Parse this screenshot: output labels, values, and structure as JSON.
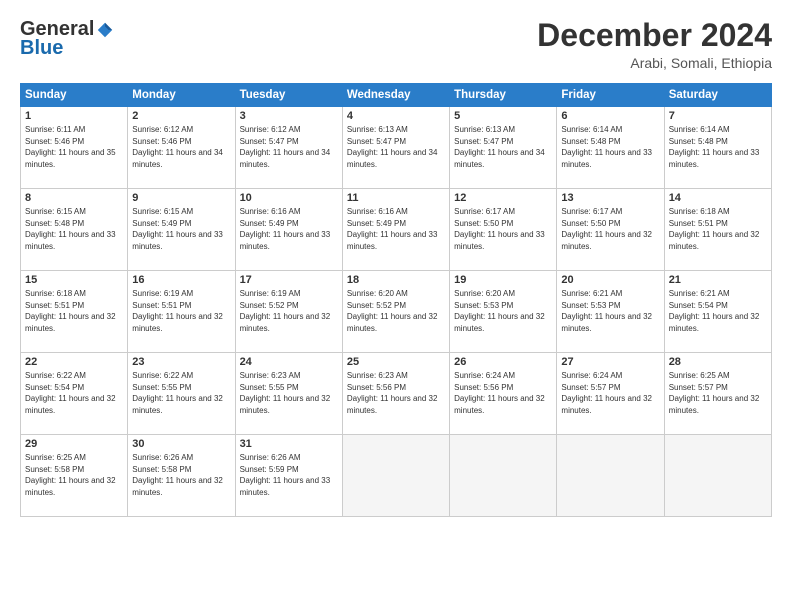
{
  "logo": {
    "general": "General",
    "blue": "Blue"
  },
  "title": "December 2024",
  "subtitle": "Arabi, Somali, Ethiopia",
  "days_header": [
    "Sunday",
    "Monday",
    "Tuesday",
    "Wednesday",
    "Thursday",
    "Friday",
    "Saturday"
  ],
  "weeks": [
    [
      {
        "day": "1",
        "sunrise": "6:11 AM",
        "sunset": "5:46 PM",
        "daylight": "11 hours and 35 minutes."
      },
      {
        "day": "2",
        "sunrise": "6:12 AM",
        "sunset": "5:46 PM",
        "daylight": "11 hours and 34 minutes."
      },
      {
        "day": "3",
        "sunrise": "6:12 AM",
        "sunset": "5:47 PM",
        "daylight": "11 hours and 34 minutes."
      },
      {
        "day": "4",
        "sunrise": "6:13 AM",
        "sunset": "5:47 PM",
        "daylight": "11 hours and 34 minutes."
      },
      {
        "day": "5",
        "sunrise": "6:13 AM",
        "sunset": "5:47 PM",
        "daylight": "11 hours and 34 minutes."
      },
      {
        "day": "6",
        "sunrise": "6:14 AM",
        "sunset": "5:48 PM",
        "daylight": "11 hours and 33 minutes."
      },
      {
        "day": "7",
        "sunrise": "6:14 AM",
        "sunset": "5:48 PM",
        "daylight": "11 hours and 33 minutes."
      }
    ],
    [
      {
        "day": "8",
        "sunrise": "6:15 AM",
        "sunset": "5:48 PM",
        "daylight": "11 hours and 33 minutes."
      },
      {
        "day": "9",
        "sunrise": "6:15 AM",
        "sunset": "5:49 PM",
        "daylight": "11 hours and 33 minutes."
      },
      {
        "day": "10",
        "sunrise": "6:16 AM",
        "sunset": "5:49 PM",
        "daylight": "11 hours and 33 minutes."
      },
      {
        "day": "11",
        "sunrise": "6:16 AM",
        "sunset": "5:49 PM",
        "daylight": "11 hours and 33 minutes."
      },
      {
        "day": "12",
        "sunrise": "6:17 AM",
        "sunset": "5:50 PM",
        "daylight": "11 hours and 33 minutes."
      },
      {
        "day": "13",
        "sunrise": "6:17 AM",
        "sunset": "5:50 PM",
        "daylight": "11 hours and 32 minutes."
      },
      {
        "day": "14",
        "sunrise": "6:18 AM",
        "sunset": "5:51 PM",
        "daylight": "11 hours and 32 minutes."
      }
    ],
    [
      {
        "day": "15",
        "sunrise": "6:18 AM",
        "sunset": "5:51 PM",
        "daylight": "11 hours and 32 minutes."
      },
      {
        "day": "16",
        "sunrise": "6:19 AM",
        "sunset": "5:51 PM",
        "daylight": "11 hours and 32 minutes."
      },
      {
        "day": "17",
        "sunrise": "6:19 AM",
        "sunset": "5:52 PM",
        "daylight": "11 hours and 32 minutes."
      },
      {
        "day": "18",
        "sunrise": "6:20 AM",
        "sunset": "5:52 PM",
        "daylight": "11 hours and 32 minutes."
      },
      {
        "day": "19",
        "sunrise": "6:20 AM",
        "sunset": "5:53 PM",
        "daylight": "11 hours and 32 minutes."
      },
      {
        "day": "20",
        "sunrise": "6:21 AM",
        "sunset": "5:53 PM",
        "daylight": "11 hours and 32 minutes."
      },
      {
        "day": "21",
        "sunrise": "6:21 AM",
        "sunset": "5:54 PM",
        "daylight": "11 hours and 32 minutes."
      }
    ],
    [
      {
        "day": "22",
        "sunrise": "6:22 AM",
        "sunset": "5:54 PM",
        "daylight": "11 hours and 32 minutes."
      },
      {
        "day": "23",
        "sunrise": "6:22 AM",
        "sunset": "5:55 PM",
        "daylight": "11 hours and 32 minutes."
      },
      {
        "day": "24",
        "sunrise": "6:23 AM",
        "sunset": "5:55 PM",
        "daylight": "11 hours and 32 minutes."
      },
      {
        "day": "25",
        "sunrise": "6:23 AM",
        "sunset": "5:56 PM",
        "daylight": "11 hours and 32 minutes."
      },
      {
        "day": "26",
        "sunrise": "6:24 AM",
        "sunset": "5:56 PM",
        "daylight": "11 hours and 32 minutes."
      },
      {
        "day": "27",
        "sunrise": "6:24 AM",
        "sunset": "5:57 PM",
        "daylight": "11 hours and 32 minutes."
      },
      {
        "day": "28",
        "sunrise": "6:25 AM",
        "sunset": "5:57 PM",
        "daylight": "11 hours and 32 minutes."
      }
    ],
    [
      {
        "day": "29",
        "sunrise": "6:25 AM",
        "sunset": "5:58 PM",
        "daylight": "11 hours and 32 minutes."
      },
      {
        "day": "30",
        "sunrise": "6:26 AM",
        "sunset": "5:58 PM",
        "daylight": "11 hours and 32 minutes."
      },
      {
        "day": "31",
        "sunrise": "6:26 AM",
        "sunset": "5:59 PM",
        "daylight": "11 hours and 33 minutes."
      },
      null,
      null,
      null,
      null
    ]
  ]
}
